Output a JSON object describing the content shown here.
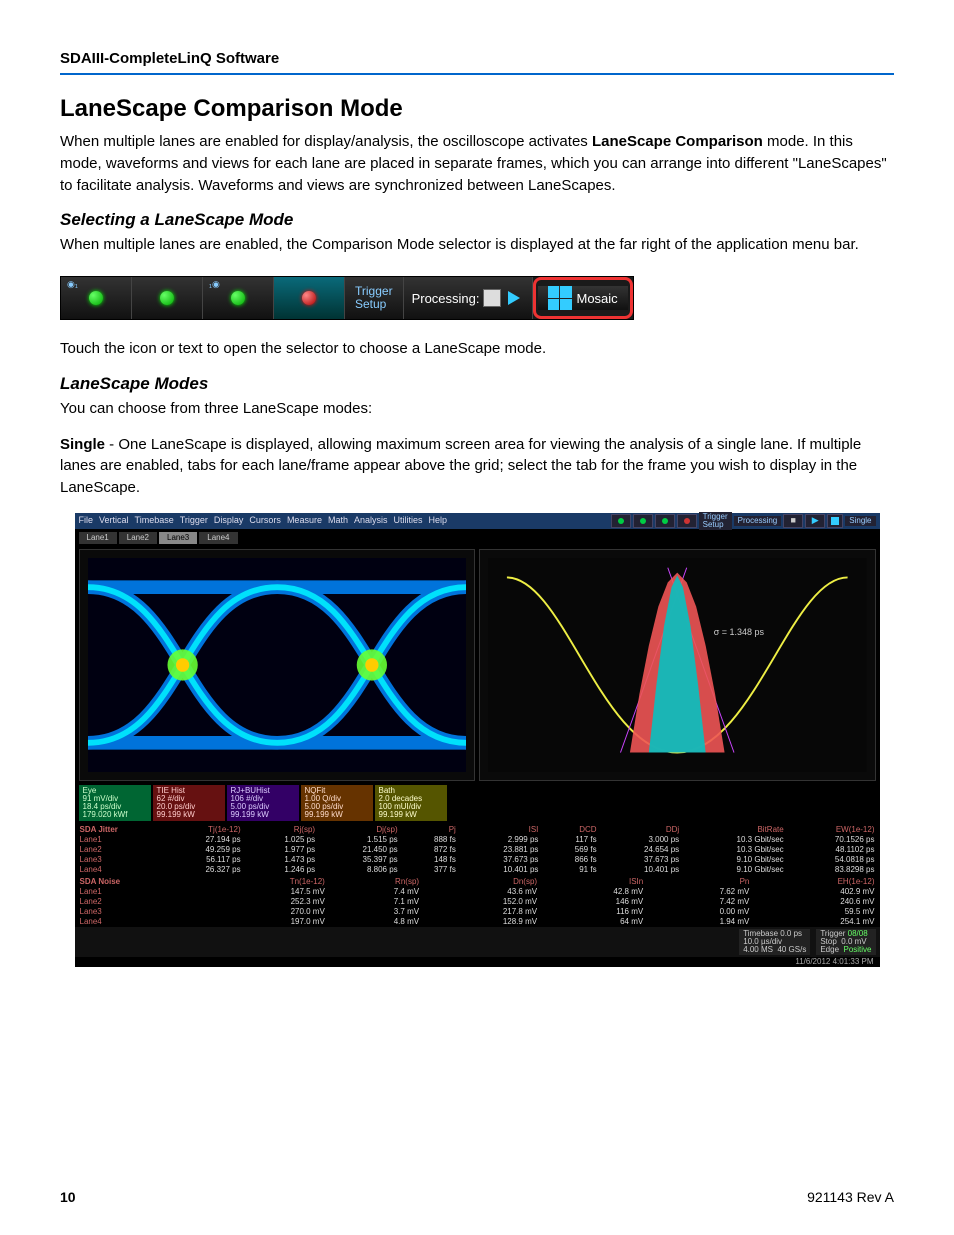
{
  "running_head": "SDAIII-CompleteLinQ Software",
  "h1": "LaneScape Comparison Mode",
  "intro_a": "When multiple lanes are enabled for display/analysis, the oscilloscope activates ",
  "intro_bold": "LaneScape Comparison",
  "intro_b": " mode. In this mode, waveforms and views for each lane are placed in separate frames, which you can arrange into different \"LaneScapes\" to facilitate analysis. Waveforms and views are synchronized between LaneScapes.",
  "h2a": "Selecting a LaneScape Mode",
  "p2": "When multiple lanes are enabled, the Comparison Mode selector is displayed at the far right of the application menu bar.",
  "toolbar": {
    "trigger1": "Trigger",
    "trigger2": "Setup",
    "processing": "Processing:",
    "mosaic": "Mosaic"
  },
  "p3": "Touch the icon or text to open the selector to choose a LaneScape mode.",
  "h2b": "LaneScape Modes",
  "p4": "You can choose from three LaneScape modes:",
  "single_label": "Single",
  "single_text": " - One LaneScape is displayed, allowing maximum screen area for viewing the analysis of a single lane. If multiple lanes are enabled, tabs for each lane/frame appear above the grid; select the tab for the frame you wish to display in the LaneScape.",
  "scope": {
    "menus": [
      "File",
      "Vertical",
      "Timebase",
      "Trigger",
      "Display",
      "Cursors",
      "Measure",
      "Math",
      "Analysis",
      "Utilities",
      "Help"
    ],
    "right_trigger": "Trigger\nSetup",
    "right_proc": "Processing",
    "right_mode": "Single",
    "tabs": [
      "Lane1",
      "Lane2",
      "Lane3",
      "Lane4"
    ],
    "active_tab": 2,
    "sigma": "σ = 1.348 ps",
    "chan": {
      "eye": {
        "name": "Eye",
        "l1": "91 mV/div",
        "l2": "18.4 ps/div",
        "l3": "179.020 kWf"
      },
      "tie": {
        "name": "TIE Hist",
        "l1": "62 #/div",
        "l2": "20.0 ps/div",
        "l3": "99.199 kW"
      },
      "rj": {
        "name": "RJ+BUHist",
        "l1": "106 #/div",
        "l2": "5.00 ps/div",
        "l3": "99.199 kW"
      },
      "nq": {
        "name": "NQFit",
        "l1": "1.00 Q/div",
        "l2": "5.00 ps/div",
        "l3": "99.199 kW"
      },
      "bath": {
        "name": "Bath",
        "l1": "2.0 decades",
        "l2": "100 mUI/div",
        "l3": "99.199 kW"
      }
    },
    "jitter_hdr": [
      "SDA Jitter",
      "Tj(1e-12)",
      "Rj(sp)",
      "Dj(sp)",
      "Pj",
      "ISI",
      "DCD",
      "DDj",
      "BitRate",
      "EW(1e-12)"
    ],
    "jitter": [
      [
        "Lane1",
        "27.194 ps",
        "1.025 ps",
        "1.515 ps",
        "888 fs",
        "2.999 ps",
        "117 fs",
        "3.000 ps",
        "10.3 Gbit/sec",
        "70.1526 ps"
      ],
      [
        "Lane2",
        "49.259 ps",
        "1.977 ps",
        "21.450 ps",
        "872 fs",
        "23.881 ps",
        "569 fs",
        "24.654 ps",
        "10.3 Gbit/sec",
        "48.1102 ps"
      ],
      [
        "Lane3",
        "56.117 ps",
        "1.473 ps",
        "35.397 ps",
        "148 fs",
        "37.673 ps",
        "866 fs",
        "37.673 ps",
        "9.10 Gbit/sec",
        "54.0818 ps"
      ],
      [
        "Lane4",
        "26.327 ps",
        "1.246 ps",
        "8.806 ps",
        "377 fs",
        "10.401 ps",
        "91 fs",
        "10.401 ps",
        "9.10 Gbit/sec",
        "83.8298 ps"
      ]
    ],
    "noise_hdr": [
      "SDA Noise",
      "Tn(1e-12)",
      "Rn(sp)",
      "Dn(sp)",
      "ISIn",
      "Pn",
      "EH(1e-12)"
    ],
    "noise": [
      [
        "Lane1",
        "147.5 mV",
        "7.4 mV",
        "43.6 mV",
        "42.8 mV",
        "7.62 mV",
        "402.9 mV"
      ],
      [
        "Lane2",
        "252.3 mV",
        "7.1 mV",
        "152.0 mV",
        "146 mV",
        "7.42 mV",
        "240.6 mV"
      ],
      [
        "Lane3",
        "270.0 mV",
        "3.7 mV",
        "217.8 mV",
        "116 mV",
        "0.00 mV",
        "59.5 mV"
      ],
      [
        "Lane4",
        "197.0 mV",
        "4.8 mV",
        "128.9 mV",
        "64 mV",
        "1.94 mV",
        "254.1 mV"
      ]
    ],
    "status": {
      "tb_lbl": "Timebase",
      "tb_v1": "0.0 ps",
      "tb_v2": "10.0 µs/div",
      "tb_v3": "4.00 MS",
      "tb_v4": "40 GS/s",
      "trg_lbl": "Trigger",
      "trg_v1": "08/08",
      "trg_v2": "0.0 mV",
      "trg_v3": "Stop",
      "trg_v4": "Edge",
      "trg_v5": "Positive"
    },
    "timestamp": "11/6/2012 4:01:33 PM"
  },
  "footer": {
    "page": "10",
    "rev": "921143 Rev A"
  }
}
